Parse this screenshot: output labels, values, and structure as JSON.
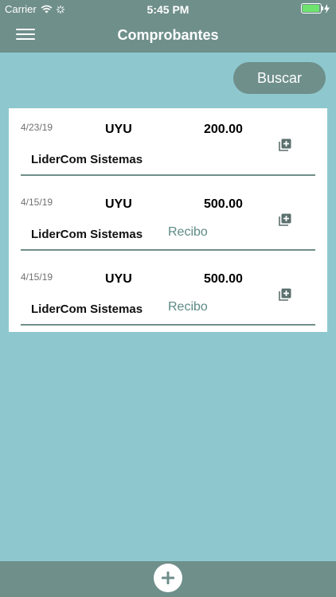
{
  "status_bar": {
    "carrier": "Carrier",
    "time": "5:45 PM",
    "battery_color": "#6ee36e"
  },
  "nav": {
    "title": "Comprobantes",
    "menu_icon": "hamburger-menu-icon"
  },
  "search_button": {
    "label": "Buscar"
  },
  "receipts": [
    {
      "date": "4/23/19",
      "currency": "UYU",
      "amount": "200.00",
      "company": "LiderCom Sistemas",
      "type": ""
    },
    {
      "date": "4/15/19",
      "currency": "UYU",
      "amount": "500.00",
      "company": "LiderCom Sistemas",
      "type": "Recibo"
    },
    {
      "date": "4/15/19",
      "currency": "UYU",
      "amount": "500.00",
      "company": "LiderCom Sistemas",
      "type": "Recibo"
    }
  ],
  "bottom_bar": {
    "add_icon": "plus-circle-icon"
  },
  "colors": {
    "accent": "#6f8f8b",
    "background": "#8ec8ce",
    "type_text": "#5d8a86"
  }
}
